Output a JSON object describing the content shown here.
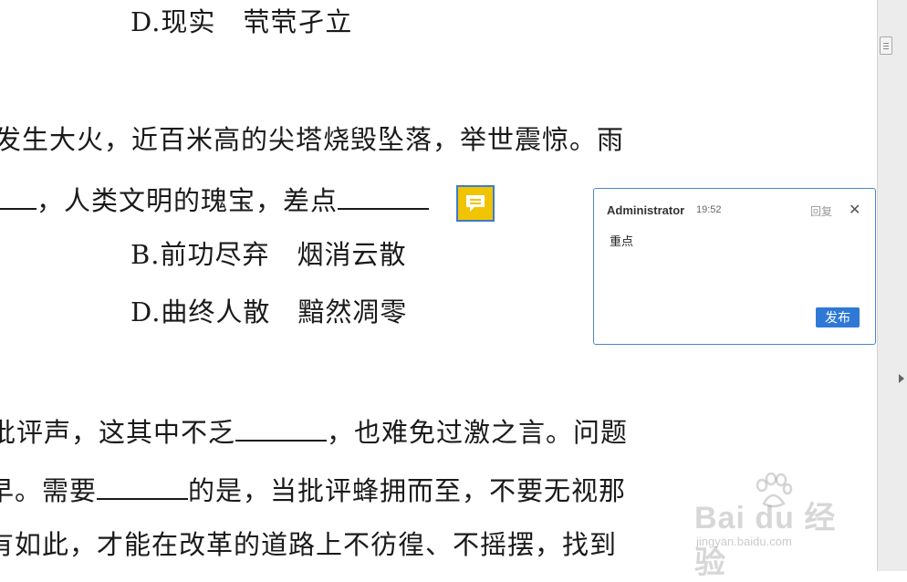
{
  "document": {
    "lines": [
      {
        "text": "D.现实　茕茕孑立"
      },
      {
        "text": "发生大火，近百米高的尖塔烧毁坠落，举世震惊。雨"
      },
      {
        "before": "，人类文明的瑰宝，差点"
      },
      {
        "text": "B.前功尽弃　烟消云散"
      },
      {
        "text": "D.曲终人散　黯然凋零"
      },
      {
        "before": "批评声，这其中不乏",
        "after": "，也难免过激之言。问题"
      },
      {
        "before": "早。需要",
        "after": "的是，当批评蜂拥而至，不要无视那"
      },
      {
        "text": "有如此，才能在改革的道路上不彷徨、不摇摆，找到"
      }
    ]
  },
  "comment_marker": {
    "icon": "comment-icon",
    "color": "#f0c400",
    "border": "#3c7bd0"
  },
  "comment_popup": {
    "author": "Administrator",
    "time": "19:52",
    "reply_label": "回复",
    "close_label": "✕",
    "body": "重点",
    "publish_label": "发布"
  },
  "watermark": {
    "main": "Bai du 经验",
    "sub": "jingyan.baidu.com"
  }
}
